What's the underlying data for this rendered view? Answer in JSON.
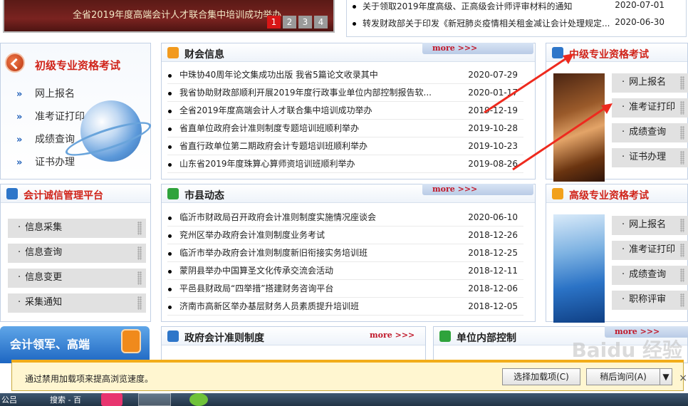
{
  "banner": {
    "caption": "全省2019年度高端会计人才联合集中培训成功举办",
    "pages": [
      "1",
      "2",
      "3",
      "4"
    ],
    "active_page": "1"
  },
  "top_news": [
    {
      "title": "关于领取2019年度高级、正高级会计师评审材料的通知",
      "date": "2020-07-01"
    },
    {
      "title": "转发财政部关于印发《新冠肺炎疫情相关租金减让会计处理规定...",
      "date": "2020-06-30"
    }
  ],
  "junior_exam": {
    "title": "初级专业资格考试",
    "links": [
      "网上报名",
      "准考证打印",
      "成绩查询",
      "证书办理"
    ]
  },
  "finance_news": {
    "title": "财会信息",
    "more": "more >>>",
    "items": [
      {
        "title": "中珠协40周年论文集成功出版 我省5篇论文收录其中",
        "date": "2020-07-29"
      },
      {
        "title": "我省协助财政部顺利开展2019年度行政事业单位内部控制报告软...",
        "date": "2020-01-17"
      },
      {
        "title": "全省2019年度高端会计人才联合集中培训成功举办",
        "date": "2019-12-19"
      },
      {
        "title": "省直单位政府会计准则制度专题培训班顺利举办",
        "date": "2019-10-28"
      },
      {
        "title": "省直行政单位第二期政府会计专题培训班顺利举办",
        "date": "2019-10-23"
      },
      {
        "title": "山东省2019年度珠算心算师资培训班顺利举办",
        "date": "2019-08-26"
      }
    ]
  },
  "mid_exam": {
    "title": "中级专业资格考试",
    "links": [
      "网上报名",
      "准考证打印",
      "成绩查询",
      "证书办理"
    ]
  },
  "credit_platform": {
    "title": "会计诚信管理平台",
    "links": [
      "信息采集",
      "信息查询",
      "信息变更",
      "采集通知"
    ]
  },
  "county_news": {
    "title": "市县动态",
    "more": "more >>>",
    "items": [
      {
        "title": "临沂市财政局召开政府会计准则制度实施情况座谈会",
        "date": "2020-06-10"
      },
      {
        "title": "兖州区举办政府会计准则制度业务考试",
        "date": "2018-12-26"
      },
      {
        "title": "临沂市举办政府会计准则制度新旧衔接实务培训班",
        "date": "2018-12-25"
      },
      {
        "title": "蒙阴县举办中国算圣文化传承交流会活动",
        "date": "2018-12-11"
      },
      {
        "title": "平邑县财政局“四举措”搭建财务咨询平台",
        "date": "2018-12-06"
      },
      {
        "title": "济南市高新区举办基层财务人员素质提升培训班",
        "date": "2018-12-05"
      }
    ]
  },
  "senior_exam": {
    "title": "高级专业资格考试",
    "links": [
      "网上报名",
      "准考证打印",
      "成绩查询",
      "职称评审"
    ]
  },
  "promo": {
    "text": "会计领军、高端"
  },
  "gov_standards": {
    "title": "政府会计准则制度",
    "more": "more >>>"
  },
  "internal_control": {
    "title": "单位内部控制",
    "more": "more >>>"
  },
  "notification": {
    "text": "通过禁用加载项来提高浏览速度。",
    "choose_label": "选择加载项(C)",
    "later_label": "稍后询问(A)",
    "dropdown": "▼",
    "close": "×"
  },
  "taskbar": {
    "left_label": "公吕",
    "search_label": "搜索 - 百"
  },
  "watermark": "Baidu 经验",
  "colors": {
    "accent_red": "#d0241a",
    "link_blue": "#1f5fb8",
    "border": "#c2d0e4",
    "notif_bg": "#fff6d0"
  }
}
